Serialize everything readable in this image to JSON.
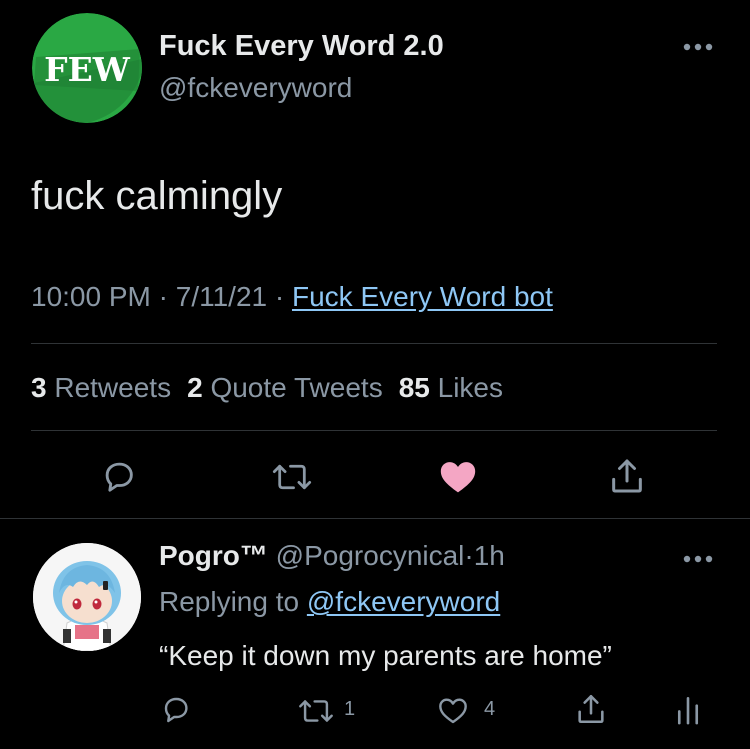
{
  "main_tweet": {
    "avatar_text": "FEW",
    "display_name": "Fuck Every Word 2.0",
    "handle": "@fckeveryword",
    "text": "fuck calmingly",
    "time": "10:00 PM",
    "date": "7/11/21",
    "separator": "·",
    "source": "Fuck Every Word bot",
    "stats": {
      "retweets_count": "3",
      "retweets_label": "Retweets",
      "quotes_count": "2",
      "quotes_label": "Quote Tweets",
      "likes_count": "85",
      "likes_label": "Likes"
    },
    "liked": true,
    "like_color": "#f4a6c4"
  },
  "reply": {
    "display_name": "Pogro™",
    "handle": "@Pogrocynical",
    "time": "1h",
    "separator": "·",
    "replying_label": "Replying to",
    "replying_handle": "@fckeveryword",
    "text": "“Keep it down my parents are home”",
    "retweet_count": "1",
    "like_count": "4"
  },
  "colors": {
    "background": "#000000",
    "primary_text": "#e7e9ea",
    "secondary_text": "#8b98a5",
    "link": "#8ec7f5",
    "divider": "#2f3336",
    "avatar_green": "#2aa844"
  },
  "icons": {
    "more": "more-horizontal-icon",
    "reply": "speech-bubble-icon",
    "retweet": "retweet-icon",
    "like": "heart-icon",
    "share": "share-upload-icon",
    "analytics": "analytics-bars-icon"
  }
}
